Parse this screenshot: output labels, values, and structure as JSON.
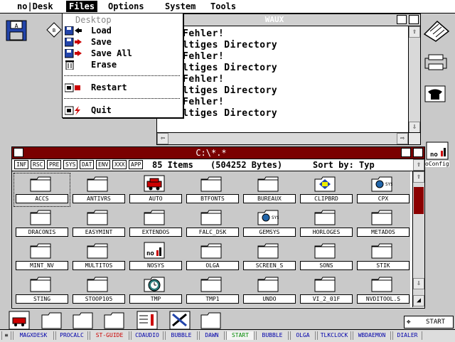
{
  "menubar": {
    "desk": "no|Desk",
    "files": "Files",
    "options": "Options",
    "system": "System",
    "tools": "Tools"
  },
  "files_menu": {
    "header": "Desktop",
    "load": "Load",
    "save": "Save",
    "save_all": "Save All",
    "erase": "Erase",
    "restart": "Restart",
    "quit": "Quit"
  },
  "console_window": {
    "title": "WAUX",
    "lines": [
      "Fehler!",
      "ltiges Directory",
      "Fehler!",
      "ltiges Directory",
      "Fehler!",
      "ltiges Directory",
      "Fehler!",
      "ltiges Directory"
    ]
  },
  "dir_window": {
    "title": "C:\\*.*",
    "toolbar_buttons": [
      "INF",
      "RSC",
      "PRE",
      "SYS",
      "DAT",
      "ENV",
      "XXX",
      "APP"
    ],
    "item_count": "85 Items",
    "bytes": "(504252 Bytes)",
    "sort_label": "Sort by: Typ",
    "items": [
      {
        "name": "ACCS",
        "icon": "folder-icon"
      },
      {
        "name": "ANTIVRS",
        "icon": "folder-icon"
      },
      {
        "name": "AUTO",
        "icon": "car-icon"
      },
      {
        "name": "BTFONTS",
        "icon": "folder-icon"
      },
      {
        "name": "BUREAUX",
        "icon": "folder-icon"
      },
      {
        "name": "CLIPBRD",
        "icon": "clipboard-icon"
      },
      {
        "name": "CPX",
        "icon": "sys-folder-icon"
      },
      {
        "name": "DRACONIS",
        "icon": "folder-icon"
      },
      {
        "name": "EASYMINT",
        "icon": "folder-icon"
      },
      {
        "name": "EXTENDOS",
        "icon": "folder-icon"
      },
      {
        "name": "FALC_DSK",
        "icon": "folder-icon"
      },
      {
        "name": "GEMSYS",
        "icon": "sys-folder-icon"
      },
      {
        "name": "HORLOGES",
        "icon": "folder-icon"
      },
      {
        "name": "METADOS",
        "icon": "folder-icon"
      },
      {
        "name": "MINT_NV",
        "icon": "folder-icon"
      },
      {
        "name": "MULTITOS",
        "icon": "folder-icon"
      },
      {
        "name": "NOSYS",
        "icon": "nosys-icon"
      },
      {
        "name": "OLGA",
        "icon": "folder-icon"
      },
      {
        "name": "SCREEN_S",
        "icon": "folder-icon"
      },
      {
        "name": "SONS",
        "icon": "folder-icon"
      },
      {
        "name": "STIK",
        "icon": "folder-icon"
      },
      {
        "name": "STING",
        "icon": "folder-icon"
      },
      {
        "name": "STOOP105",
        "icon": "folder-icon"
      },
      {
        "name": "TMP",
        "icon": "clock-icon"
      },
      {
        "name": "TMP1",
        "icon": "folder-icon"
      },
      {
        "name": "UNDO",
        "icon": "folder-icon"
      },
      {
        "name": "VI_2_01F",
        "icon": "folder-icon"
      },
      {
        "name": "NVDITOOL.S",
        "icon": "folder-icon"
      }
    ]
  },
  "desktop": {
    "nosys_label": "oConfig",
    "start_label": "START"
  },
  "taskbar": {
    "items": [
      {
        "label": "≡",
        "color": "#000000"
      },
      {
        "label": "MAGXDESK",
        "color": "#0000aa"
      },
      {
        "label": "PROCALC",
        "color": "#0000aa"
      },
      {
        "label": "ST-GUIDE",
        "color": "#cc0000"
      },
      {
        "label": "CDAUDIO",
        "color": "#0000aa"
      },
      {
        "label": "BUBBLE",
        "color": "#0000aa"
      },
      {
        "label": "DAWN",
        "color": "#0000aa"
      },
      {
        "label": "START",
        "color": "#008800"
      },
      {
        "label": "BUBBLE",
        "color": "#0000aa"
      },
      {
        "label": "OLGA",
        "color": "#0000aa"
      },
      {
        "label": "TLKCLOCK",
        "color": "#0000aa"
      },
      {
        "label": "WBDAEMON",
        "color": "#0000aa"
      },
      {
        "label": "DIALER",
        "color": "#0000aa"
      }
    ]
  },
  "colors": {
    "titlebar_dir": "#7a0000",
    "scroll_red": "#8b0000",
    "desktop_bg": "#c9c9c9"
  }
}
